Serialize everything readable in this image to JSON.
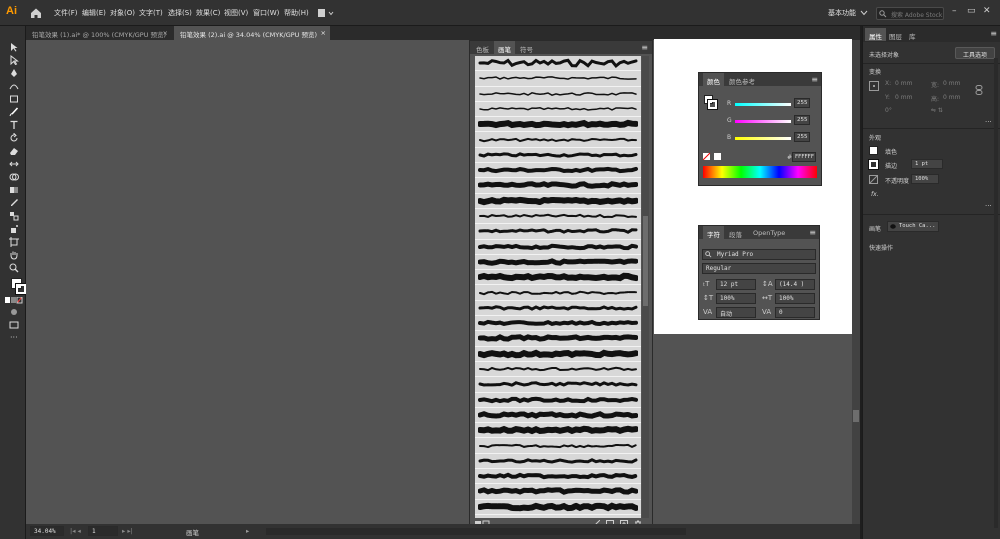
{
  "app": {
    "logo_text": "Ai"
  },
  "menu": [
    "文件(F)",
    "编辑(E)",
    "对象(O)",
    "文字(T)",
    "选择(S)",
    "效果(C)",
    "视图(V)",
    "窗口(W)",
    "帮助(H)"
  ],
  "workspace_label": "基本功能",
  "search_placeholder": "搜索 Adobe Stock",
  "doc_tabs": [
    {
      "label": "铅笔效果 (1).ai* @ 100% (CMYK/GPU 预览)",
      "close": "×"
    },
    {
      "label": "铅笔效果 (2).ai @ 34.04% (CMYK/GPU 预览)",
      "close": "×"
    }
  ],
  "status": {
    "zoom": "34.04%",
    "artboard_num": "1",
    "tool_name": "画笔"
  },
  "brushes_panel": {
    "tabs": [
      "色板",
      "画笔",
      "符号"
    ],
    "brush_count": 30
  },
  "color_panel": {
    "tabs": [
      "颜色",
      "颜色参考"
    ],
    "channels": [
      {
        "label": "R",
        "value": "255"
      },
      {
        "label": "G",
        "value": "255"
      },
      {
        "label": "B",
        "value": "255"
      }
    ],
    "hex_label": "#",
    "hex_value": "FFFFFF"
  },
  "char_panel": {
    "tabs": [
      "字符",
      "段落",
      "OpenType"
    ],
    "font_family": "Myriad Pro",
    "font_style": "Regular",
    "font_size": "12 pt",
    "leading": "(14.4 )",
    "vscale": "100%",
    "hscale": "100%",
    "kerning": "自动",
    "tracking": "0"
  },
  "properties": {
    "tabs": [
      "属性",
      "图层",
      "库"
    ],
    "no_selection": "未选择对象",
    "doc_button": "工具选项",
    "transform_title": "变换",
    "x_label": "X:",
    "y_label": "Y:",
    "w_label": "宽:",
    "h_label": "高:",
    "field_placeholder": "0 mm",
    "angle_value": "0°",
    "appearance_title": "外观",
    "fill_label": "填色",
    "stroke_label": "描边",
    "stroke_weight": "1 pt",
    "opacity_label": "不透明度",
    "opacity_value": "100%",
    "fx_label": "fx.",
    "brush_label": "画笔",
    "brush_value": "Touch Ca...",
    "quick_actions": "快速操作"
  },
  "colors": {
    "accent": "#ff9a00",
    "canvas": "#535353",
    "artboard": "#ffffff",
    "chrome": "#323232"
  }
}
